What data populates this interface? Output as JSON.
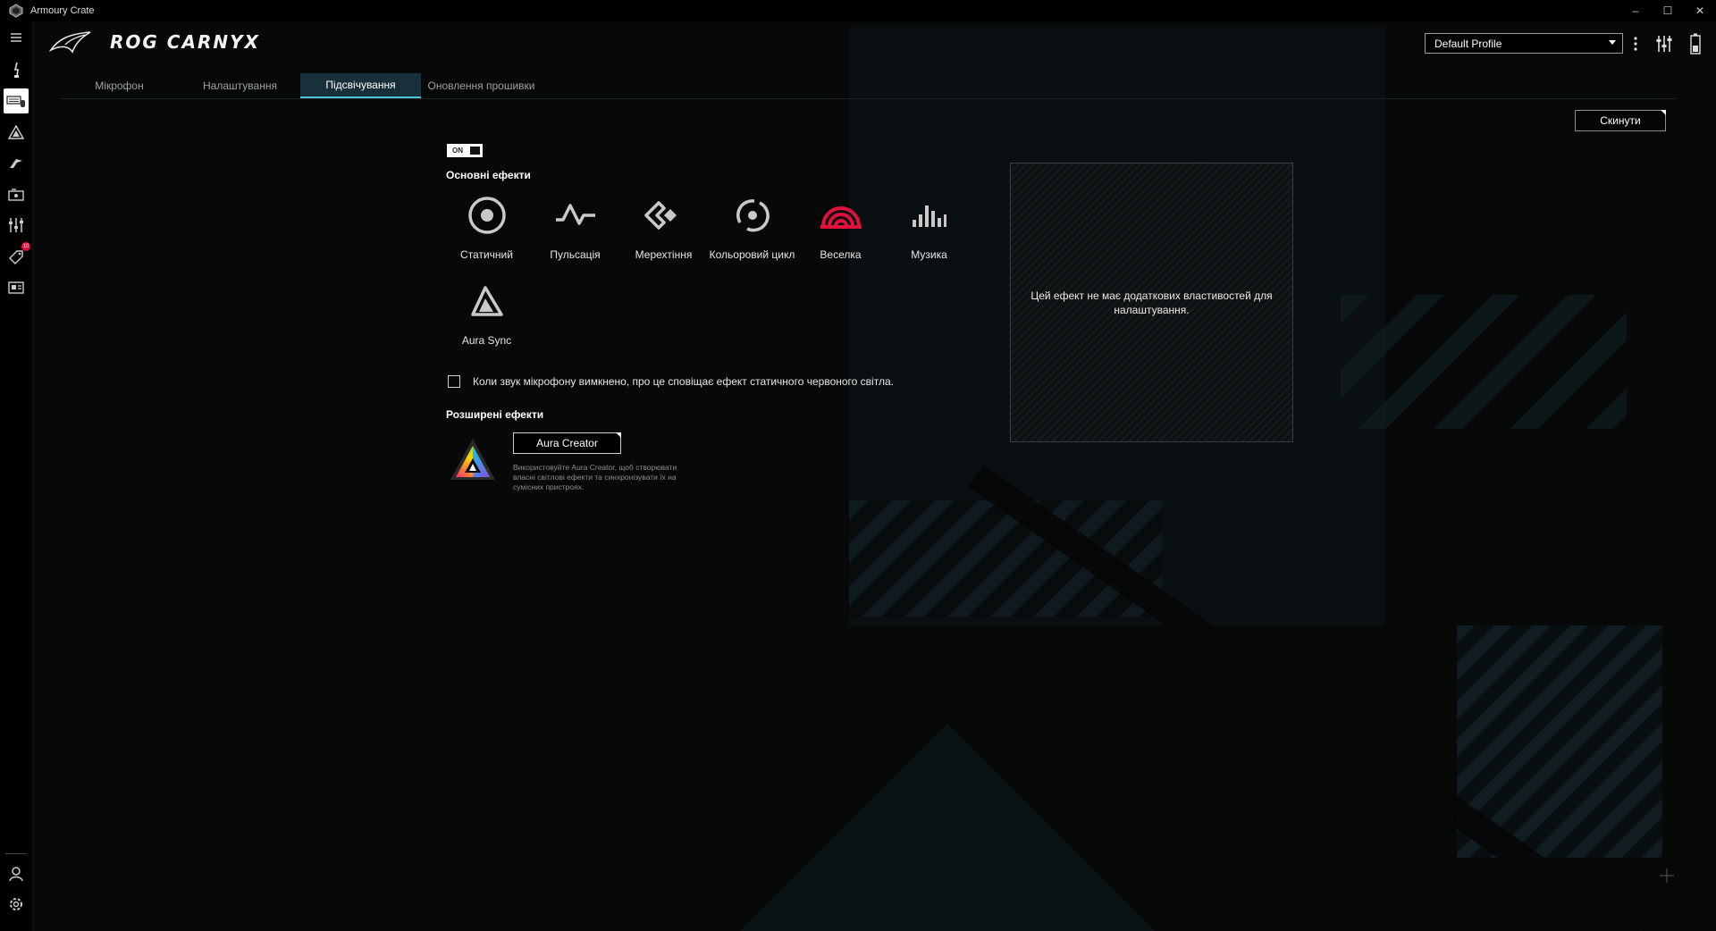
{
  "window": {
    "title": "Armoury Crate",
    "controls": [
      "–",
      "☐",
      "✕"
    ]
  },
  "rail": {
    "items": [
      {
        "icon": "menu-icon"
      },
      {
        "icon": "device-microphone-icon"
      },
      {
        "icon": "keyboard-mouse-icon",
        "active": true
      },
      {
        "icon": "aura-icon"
      },
      {
        "icon": "armoury-game-icon"
      },
      {
        "icon": "gamevisual-icon"
      },
      {
        "icon": "settings-sliders-icon"
      },
      {
        "icon": "deals-tag-icon",
        "badge": "10"
      },
      {
        "icon": "news-icon"
      }
    ],
    "bottom": [
      {
        "icon": "user-icon"
      },
      {
        "icon": "gear-icon"
      }
    ]
  },
  "header": {
    "device_name": "ROG CARNYX",
    "profile": "Default Profile"
  },
  "tabs": [
    {
      "label": "Мікрофон",
      "active": false
    },
    {
      "label": "Налаштування",
      "active": false
    },
    {
      "label": "Підсвічування",
      "active": true
    },
    {
      "label": "Оновлення прошивки",
      "active": false
    }
  ],
  "reset_label": "Скинути",
  "toggle": {
    "label": "ON",
    "state": "on"
  },
  "basic_effects": {
    "title": "Основні ефекти",
    "items": [
      {
        "label": "Статичний",
        "icon": "static-icon"
      },
      {
        "label": "Пульсація",
        "icon": "breathing-icon"
      },
      {
        "label": "Мерехтіння",
        "icon": "strobing-icon"
      },
      {
        "label": "Кольоровий цикл",
        "icon": "color-cycle-icon"
      },
      {
        "label": "Веселка",
        "icon": "rainbow-icon",
        "selected": true,
        "color": "#e0103d"
      },
      {
        "label": "Музика",
        "icon": "music-icon"
      },
      {
        "label": "Aura Sync",
        "icon": "aura-sync-icon"
      }
    ]
  },
  "mute_checkbox": {
    "checked": false,
    "label": "Коли звук мікрофону вимкнено, про це сповіщає ефект статичного червоного світла."
  },
  "advanced_effects": {
    "title": "Розширені ефекти",
    "button": "Aura Creator",
    "description": "Використовуйте Aura Creator, щоб створювати власні світлові ефекти та синхронізувати їх на сумісних пристроях."
  },
  "info_panel": {
    "text": "Цей ефект не має додаткових властивостей для налаштування."
  },
  "colors": {
    "accent": "#4fc3d4",
    "selected": "#e0103d",
    "background": "#070909"
  }
}
